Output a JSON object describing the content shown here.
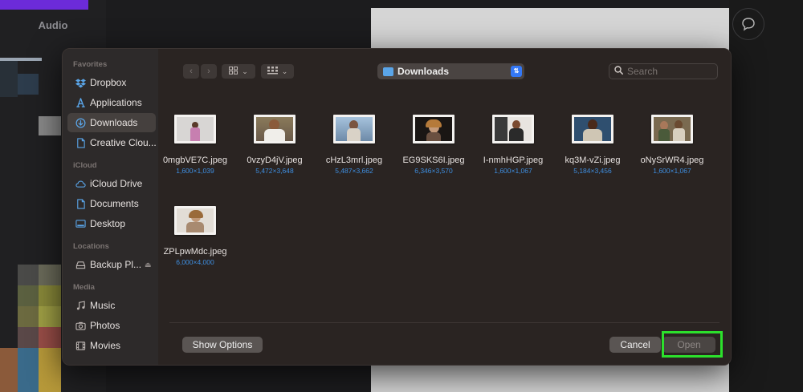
{
  "background": {
    "panel_label": "Audio",
    "accent": "#6c2bd9"
  },
  "sidebar": {
    "sections": [
      {
        "title": "Favorites",
        "items": [
          {
            "label": "Dropbox",
            "icon": "dropbox-icon"
          },
          {
            "label": "Applications",
            "icon": "applications-icon"
          },
          {
            "label": "Downloads",
            "icon": "downloads-icon",
            "selected": true
          },
          {
            "label": "Creative Clou...",
            "icon": "document-icon"
          }
        ]
      },
      {
        "title": "iCloud",
        "items": [
          {
            "label": "iCloud Drive",
            "icon": "cloud-icon"
          },
          {
            "label": "Documents",
            "icon": "document-icon"
          },
          {
            "label": "Desktop",
            "icon": "desktop-icon"
          }
        ]
      },
      {
        "title": "Locations",
        "items": [
          {
            "label": "Backup Pl...",
            "icon": "drive-icon",
            "eject": true
          }
        ]
      },
      {
        "title": "Media",
        "items": [
          {
            "label": "Music",
            "icon": "music-icon"
          },
          {
            "label": "Photos",
            "icon": "camera-icon"
          },
          {
            "label": "Movies",
            "icon": "film-icon"
          }
        ]
      }
    ]
  },
  "toolbar": {
    "location": "Downloads",
    "search_placeholder": "Search"
  },
  "files": [
    {
      "name": "0mgbVE7C.jpeg",
      "dims": "1,600×1,039"
    },
    {
      "name": "0vzyD4jV.jpeg",
      "dims": "5,472×3,648"
    },
    {
      "name": "cHzL3mrl.jpeg",
      "dims": "5,487×3,662"
    },
    {
      "name": "EG9SKS6I.jpeg",
      "dims": "6,346×3,570"
    },
    {
      "name": "I-nmhHGP.jpeg",
      "dims": "1,600×1,067"
    },
    {
      "name": "kq3M-vZi.jpeg",
      "dims": "5,184×3,456"
    },
    {
      "name": "oNySrWR4.jpeg",
      "dims": "1,600×1,067"
    },
    {
      "name": "ZPLpwMdc.jpeg",
      "dims": "6,000×4,000"
    }
  ],
  "footer": {
    "options_label": "Show Options",
    "cancel_label": "Cancel",
    "open_label": "Open"
  },
  "colors": {
    "highlight": "#2ce02c",
    "link_blue": "#3e8ee0",
    "select_blue": "#3478f6"
  }
}
